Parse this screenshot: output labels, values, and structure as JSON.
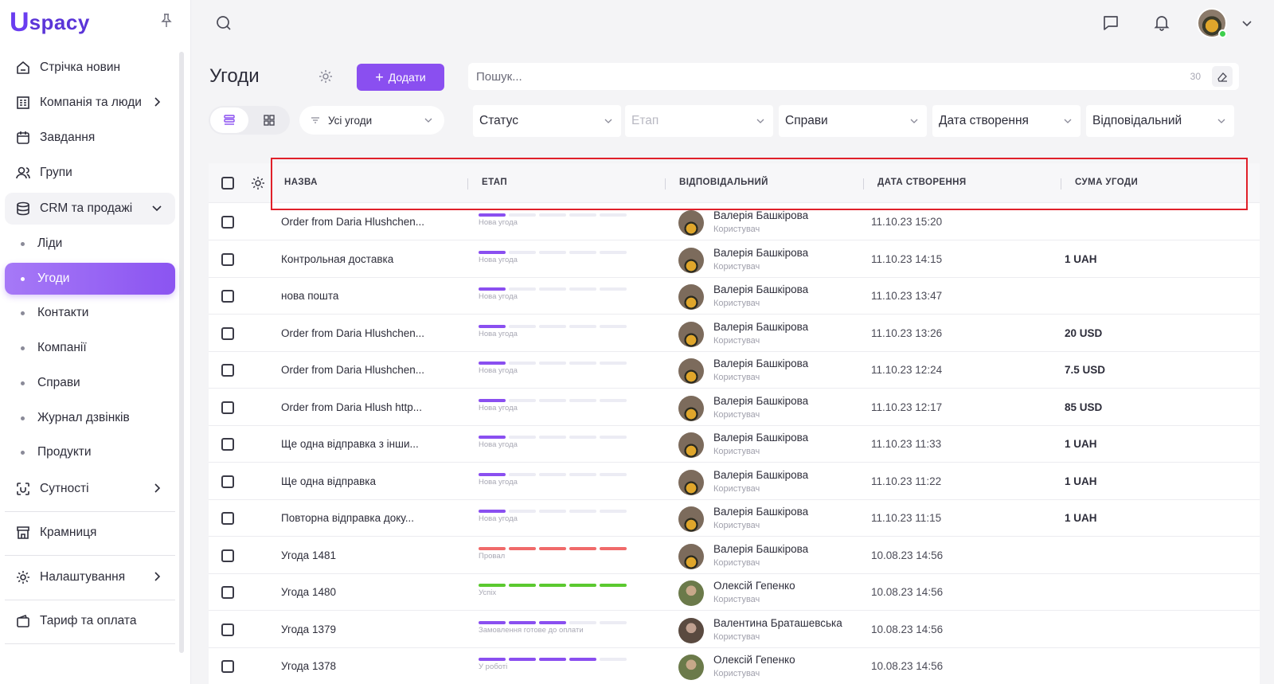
{
  "app": {
    "logo_mark": "U",
    "logo_text": "spacy"
  },
  "sidebar": {
    "items": [
      {
        "label": "Стрічка новин",
        "icon": "home-icon"
      },
      {
        "label": "Компанія та люди",
        "icon": "building-icon",
        "has_chevron": true
      },
      {
        "label": "Завдання",
        "icon": "calendar-icon"
      },
      {
        "label": "Групи",
        "icon": "users-icon"
      },
      {
        "label": "CRM та продажі",
        "icon": "database-icon",
        "expanded": true
      },
      {
        "label": "Сутності",
        "icon": "scan-icon",
        "has_chevron": true
      },
      {
        "label": "Крамниця",
        "icon": "store-icon"
      },
      {
        "label": "Налаштування",
        "icon": "gear-icon",
        "has_chevron": true
      },
      {
        "label": "Тариф та оплата",
        "icon": "wallet-icon"
      }
    ],
    "crm_sub": [
      "Ліди",
      "Угоди",
      "Контакти",
      "Компанії",
      "Справи",
      "Журнал дзвінків",
      "Продукти"
    ],
    "active_sub": "Угоди"
  },
  "header": {
    "title": "Угоди",
    "add_label": "Додати",
    "search_placeholder": "Пошук...",
    "search_count": "30"
  },
  "filters": {
    "preset": "Усі угоди",
    "status": "Статус",
    "stage": "Етап",
    "affairs": "Справи",
    "created": "Дата створення",
    "responsible": "Відповідальний"
  },
  "table": {
    "columns": [
      "НАЗВА",
      "ЕТАП",
      "ВІДПОВІДАЛЬНИЙ",
      "ДАТА СТВОРЕННЯ",
      "СУМА УГОДИ"
    ],
    "rows": [
      {
        "name": "Order from Daria Hlushchen...",
        "stage": "Нова угода",
        "stage_filled": 1,
        "stage_color": "#8a4ff0",
        "resp": "Валерія Башкірова",
        "role": "Користувач",
        "avatar": "v",
        "date": "11.10.23 15:20",
        "sum": ""
      },
      {
        "name": "Контрольная доставка",
        "stage": "Нова угода",
        "stage_filled": 1,
        "stage_color": "#8a4ff0",
        "resp": "Валерія Башкірова",
        "role": "Користувач",
        "avatar": "v",
        "date": "11.10.23 14:15",
        "sum": "1 UAH"
      },
      {
        "name": "нова пошта",
        "stage": "Нова угода",
        "stage_filled": 1,
        "stage_color": "#8a4ff0",
        "resp": "Валерія Башкірова",
        "role": "Користувач",
        "avatar": "v",
        "date": "11.10.23 13:47",
        "sum": ""
      },
      {
        "name": "Order from Daria Hlushchen...",
        "stage": "Нова угода",
        "stage_filled": 1,
        "stage_color": "#8a4ff0",
        "resp": "Валерія Башкірова",
        "role": "Користувач",
        "avatar": "v",
        "date": "11.10.23 13:26",
        "sum": "20 USD"
      },
      {
        "name": "Order from Daria Hlushchen...",
        "stage": "Нова угода",
        "stage_filled": 1,
        "stage_color": "#8a4ff0",
        "resp": "Валерія Башкірова",
        "role": "Користувач",
        "avatar": "v",
        "date": "11.10.23 12:24",
        "sum": "7.5 USD"
      },
      {
        "name": "Order from Daria Hlush http...",
        "stage": "Нова угода",
        "stage_filled": 1,
        "stage_color": "#8a4ff0",
        "resp": "Валерія Башкірова",
        "role": "Користувач",
        "avatar": "v",
        "date": "11.10.23 12:17",
        "sum": "85 USD"
      },
      {
        "name": "Ще одна відправка з інши...",
        "stage": "Нова угода",
        "stage_filled": 1,
        "stage_color": "#8a4ff0",
        "resp": "Валерія Башкірова",
        "role": "Користувач",
        "avatar": "v",
        "date": "11.10.23 11:33",
        "sum": "1 UAH"
      },
      {
        "name": "Ще одна відправка",
        "stage": "Нова угода",
        "stage_filled": 1,
        "stage_color": "#8a4ff0",
        "resp": "Валерія Башкірова",
        "role": "Користувач",
        "avatar": "v",
        "date": "11.10.23 11:22",
        "sum": "1 UAH"
      },
      {
        "name": "Повторна відправка доку...",
        "stage": "Нова угода",
        "stage_filled": 1,
        "stage_color": "#8a4ff0",
        "resp": "Валерія Башкірова",
        "role": "Користувач",
        "avatar": "v",
        "date": "11.10.23 11:15",
        "sum": "1 UAH"
      },
      {
        "name": "Угода 1481",
        "stage": "Провал",
        "stage_filled": 5,
        "stage_color": "#f06a6a",
        "resp": "Валерія Башкірова",
        "role": "Користувач",
        "avatar": "v",
        "date": "10.08.23 14:56",
        "sum": ""
      },
      {
        "name": "Угода 1480",
        "stage": "Успіх",
        "stage_filled": 5,
        "stage_color": "#5bc92f",
        "resp": "Олексій Гепенко",
        "role": "Користувач",
        "avatar": "o",
        "date": "10.08.23 14:56",
        "sum": ""
      },
      {
        "name": "Угода 1379",
        "stage": "Замовлення готове до оплати",
        "stage_filled": 3,
        "stage_color": "#8a4ff0",
        "resp": "Валентина Браташевська",
        "role": "Користувач",
        "avatar": "b",
        "date": "10.08.23 14:56",
        "sum": ""
      },
      {
        "name": "Угода 1378",
        "stage": "У роботі",
        "stage_filled": 4,
        "stage_color": "#8a4ff0",
        "resp": "Олексій Гепенко",
        "role": "Користувач",
        "avatar": "o",
        "date": "10.08.23 14:56",
        "sum": ""
      }
    ]
  },
  "colors": {
    "accent": "#8a4ff0",
    "highlight": "#e0202a"
  }
}
